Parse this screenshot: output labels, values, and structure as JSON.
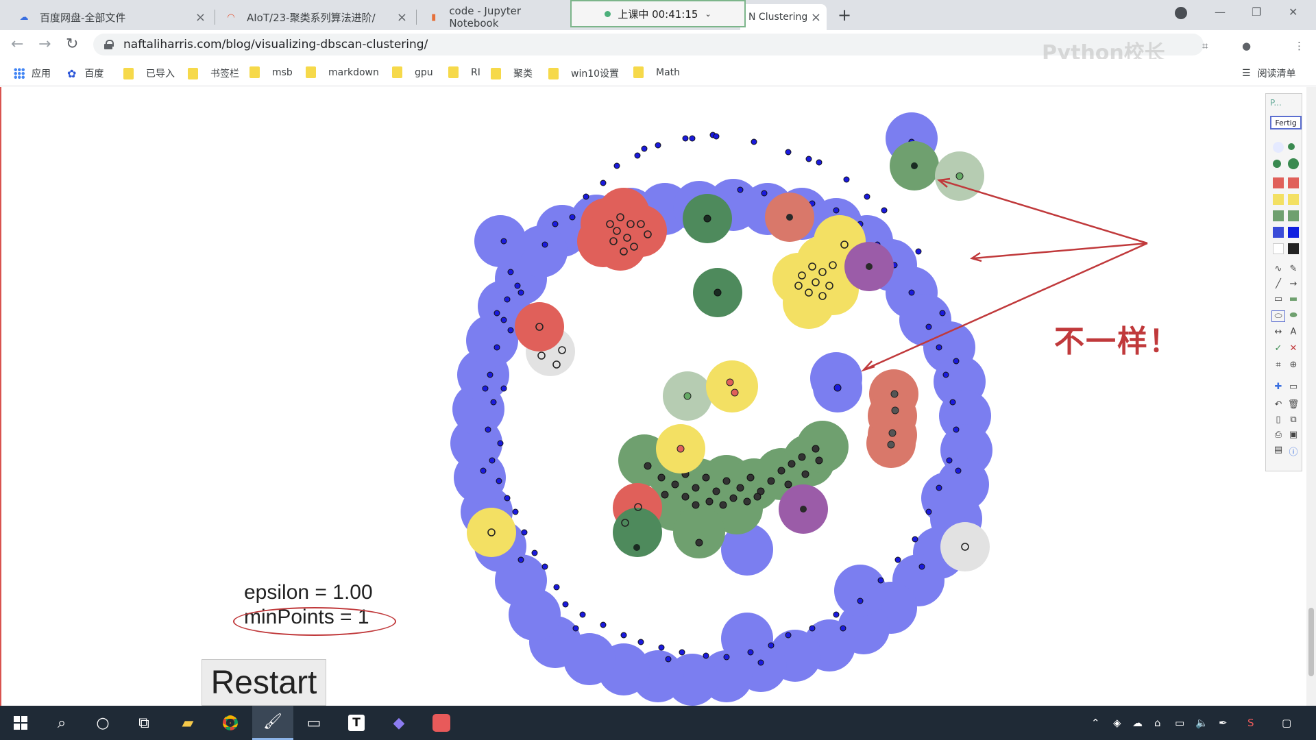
{
  "browser": {
    "tabs": [
      {
        "title": "百度网盘-全部文件",
        "icon": "baidu-cloud-icon"
      },
      {
        "title": "AIoT/23-聚类系列算法进阶/",
        "icon": "loading-spinner-icon"
      },
      {
        "title": "code - Jupyter Notebook",
        "icon": "jupyter-book-icon"
      },
      {
        "title": "N Clustering",
        "icon": "page-icon"
      }
    ],
    "timer_text": "上课中 00:41:15",
    "url": "naftaliharris.com/blog/visualizing-dbscan-clustering/",
    "watermark": "Python校长",
    "bookmarks": [
      {
        "label": "应用",
        "icon": "apps-grid-icon"
      },
      {
        "label": "百度",
        "icon": "baidu-paw-icon"
      },
      {
        "label": "已导入",
        "icon": "folder-icon"
      },
      {
        "label": "书签栏",
        "icon": "folder-icon"
      },
      {
        "label": "msb",
        "icon": "folder-icon"
      },
      {
        "label": "markdown",
        "icon": "folder-icon"
      },
      {
        "label": "gpu",
        "icon": "folder-icon"
      },
      {
        "label": "RI",
        "icon": "folder-icon"
      },
      {
        "label": "聚类",
        "icon": "folder-icon"
      },
      {
        "label": "win10设置",
        "icon": "folder-icon"
      },
      {
        "label": "Math",
        "icon": "folder-icon"
      }
    ],
    "reading_list": "阅读清单"
  },
  "demo": {
    "epsilon_text": "epsilon = 1.00",
    "minpoints_text": "minPoints = 1",
    "restart_label": "Restart",
    "annotation": "不一样！",
    "colors": {
      "blue": "#7b7ef0",
      "green": "#6fa06f",
      "darkgreen": "#4e8a5c",
      "red": "#e0605a",
      "yellow": "#f3e063",
      "purple": "#9b5ca8",
      "gray": "#e2e2e2",
      "lightgreen": "#b6ccb2",
      "annotation_red": "#c0393b"
    }
  },
  "drawing_toolbar": {
    "title": "P...",
    "done_label": "Fertig"
  },
  "taskbar": {
    "apps": [
      "start-icon",
      "search-icon",
      "cortana-icon",
      "task-view-icon",
      "file-explorer-icon",
      "chrome-icon",
      "paint-icon",
      "terminal-icon",
      "typora-icon",
      "video-icon",
      "pdf-icon"
    ]
  }
}
